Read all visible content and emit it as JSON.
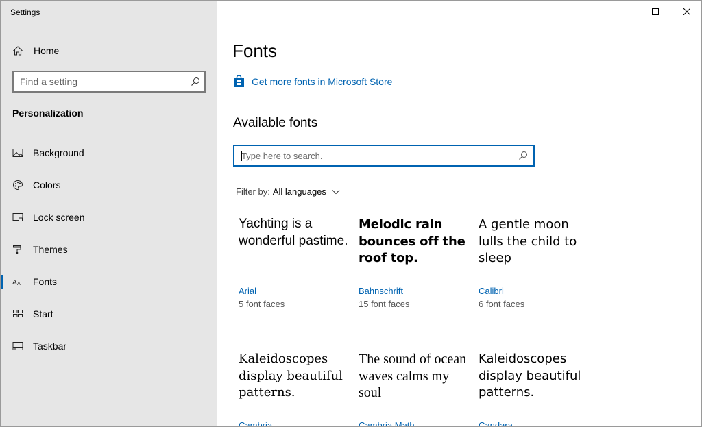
{
  "window": {
    "title": "Settings",
    "controls": {
      "minimize": "minimize",
      "maximize": "maximize",
      "close": "close"
    }
  },
  "sidebar": {
    "home": {
      "label": "Home",
      "icon": "home-icon"
    },
    "search": {
      "placeholder": "Find a setting",
      "value": ""
    },
    "section": "Personalization",
    "items": [
      {
        "label": "Background",
        "icon": "background-icon",
        "active": false
      },
      {
        "label": "Colors",
        "icon": "palette-icon",
        "active": false
      },
      {
        "label": "Lock screen",
        "icon": "lock-screen-icon",
        "active": false
      },
      {
        "label": "Themes",
        "icon": "themes-icon",
        "active": false
      },
      {
        "label": "Fonts",
        "icon": "fonts-icon",
        "active": true
      },
      {
        "label": "Start",
        "icon": "start-icon",
        "active": false
      },
      {
        "label": "Taskbar",
        "icon": "taskbar-icon",
        "active": false
      }
    ]
  },
  "main": {
    "title": "Fonts",
    "store_link": "Get more fonts in Microsoft Store",
    "available_heading": "Available fonts",
    "search": {
      "placeholder": "Type here to search.",
      "value": ""
    },
    "filter": {
      "label": "Filter by:",
      "value": "All languages"
    },
    "fonts": [
      {
        "sample": "Yachting is a wonderful pastime.",
        "name": "Arial",
        "faces": "5 font faces"
      },
      {
        "sample": "Melodic rain bounces off the roof top.",
        "name": "Bahnschrift",
        "faces": "15 font faces"
      },
      {
        "sample": "A gentle moon lulls the child to sleep",
        "name": "Calibri",
        "faces": "6 font faces"
      },
      {
        "sample": "Kaleidoscopes display beautiful patterns.",
        "name": "Cambria",
        "faces": ""
      },
      {
        "sample": "The sound of ocean waves calms my soul",
        "name": "Cambria Math",
        "faces": ""
      },
      {
        "sample": "Kaleidoscopes display beautiful patterns.",
        "name": "Candara",
        "faces": ""
      }
    ]
  },
  "colors": {
    "accent": "#0063b1",
    "sidebar_bg": "#e6e6e6"
  }
}
